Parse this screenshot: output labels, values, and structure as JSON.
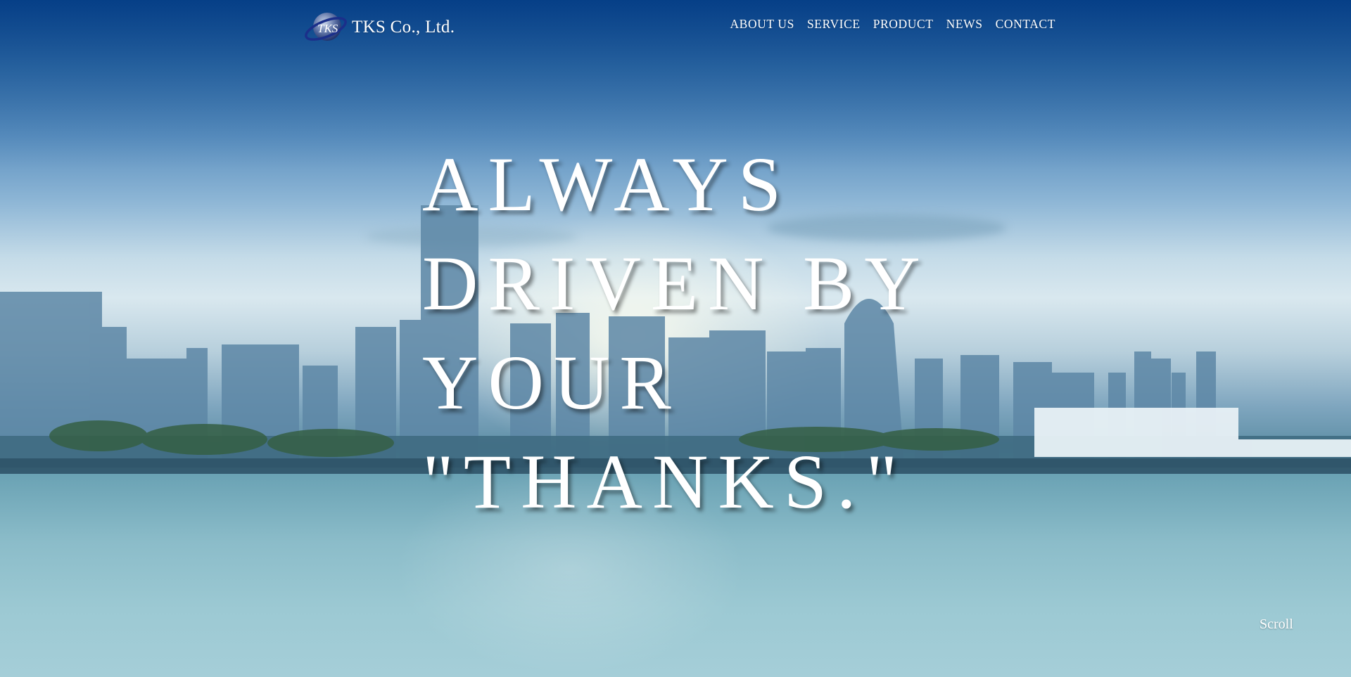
{
  "brand": {
    "logo_icon": "tks-globe-logo",
    "logo_mark_text": "TKS",
    "name": "TKS Co., Ltd."
  },
  "nav": {
    "items": [
      {
        "label": "ABOUT US"
      },
      {
        "label": "SERVICE"
      },
      {
        "label": "PRODUCT"
      },
      {
        "label": "NEWS"
      },
      {
        "label": "CONTACT"
      }
    ]
  },
  "hero": {
    "background": "yokohama-harbor-skyline-photo",
    "headline_lines": [
      "ALWAYS",
      "DRIVEN BY",
      "YOUR",
      "\"THANKS.\""
    ],
    "scroll_label": "Scroll"
  },
  "colors": {
    "sky_top": "#06408a",
    "water": "#9cc9d3",
    "text": "#ffffff"
  }
}
